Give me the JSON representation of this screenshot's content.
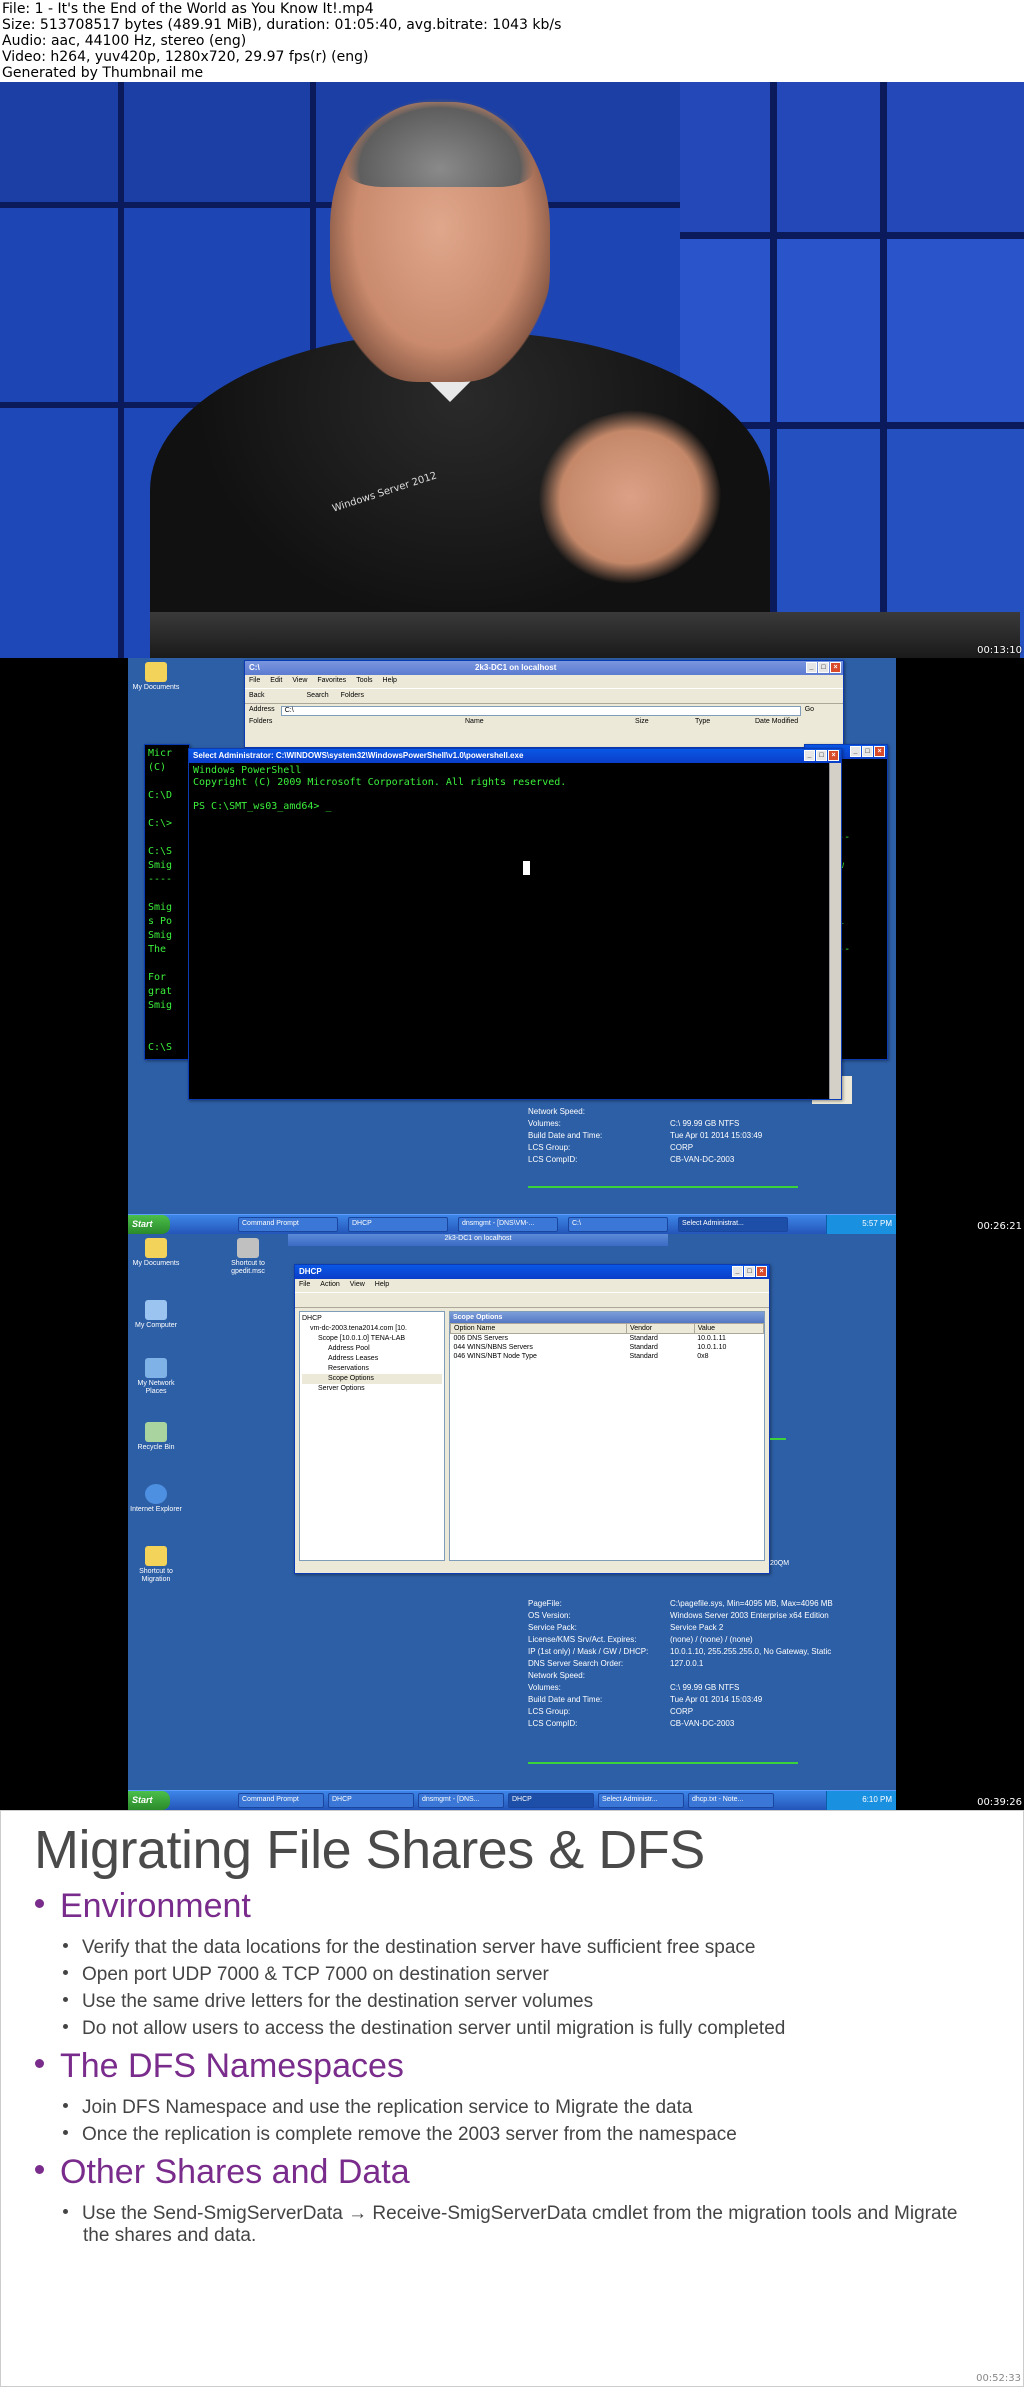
{
  "info": {
    "line1": "File: 1 - It's the End of the World as You Know It!.mp4",
    "line2": "Size: 513708517 bytes (489.91 MiB), duration: 01:05:40, avg.bitrate: 1043 kb/s",
    "line3": "Audio: aac, 44100 Hz, stereo (eng)",
    "line4": "Video: h264, yuv420p, 1280x720, 29.97 fps(r) (eng)",
    "line5": "Generated by Thumbnail me"
  },
  "timestamps": [
    "00:13:10",
    "00:26:21",
    "00:39:26",
    "00:52:33"
  ],
  "frame1": {
    "shirt_logo": "Windows Server 2012"
  },
  "frame2": {
    "icons": [
      "My Documents"
    ],
    "explorer": {
      "title": "C:\\",
      "title_center": "2k3-DC1 on localhost",
      "menu": [
        "File",
        "Edit",
        "View",
        "Favorites",
        "Tools",
        "Help"
      ],
      "toolbar": [
        "Back",
        "Search",
        "Folders"
      ],
      "address_label": "Address",
      "address_value": "C:\\",
      "go": "Go",
      "cols": [
        "Folders",
        "Name",
        "Size",
        "Type",
        "Date Modified"
      ]
    },
    "cmd_left": [
      "Micr",
      "(C)",
      "",
      "C:\\D",
      "",
      "C:\\>",
      "",
      "C:\\S",
      "Smig",
      "----",
      "",
      "Smig",
      "s Po",
      "Smig",
      "The ",
      "",
      "For ",
      "grat",
      "Smig",
      "",
      "",
      "C:\\S"
    ],
    "cmd_right": [
      "",
      "",
      "",
      "",
      "",
      "-------",
      "",
      "Window",
      "",
      "",
      "",
      "the mi",
      "",
      "-------"
    ],
    "powershell": {
      "title": "Select Administrator: C:\\WINDOWS\\system32\\WindowsPowerShell\\v1.0\\powershell.exe",
      "lines": [
        "Windows PowerShell",
        "Copyright (C) 2009 Microsoft Corporation. All rights reserved.",
        "",
        "PS C:\\SMT_ws03_amd64> _"
      ]
    },
    "sysinfo": [
      [
        "Network Speed:",
        ""
      ],
      [
        "Volumes:",
        "C:\\ 99.99 GB NTFS"
      ],
      [
        "Build Date and Time:",
        "Tue Apr 01 2014 15:03:49"
      ],
      [
        "LCS Group:",
        "CORP"
      ],
      [
        "LCS CompID:",
        "CB-VAN-DC-2003"
      ]
    ],
    "static_label": "tatic",
    "taskbar": {
      "start": "Start",
      "buttons": [
        "Command Prompt",
        "DHCP",
        "dnsmgmt - [DNS\\VM-...",
        "C:\\",
        "Select Administrat..."
      ],
      "clock": "5:57 PM"
    }
  },
  "frame3": {
    "icons": [
      "My Documents",
      "My Computer",
      "My Network Places",
      "Recycle Bin",
      "Internet Explorer",
      "Shortcut to Migration",
      "Shortcut to gpedit.msc"
    ],
    "remote_title": "2k3-DC1 on localhost",
    "dhcp": {
      "title": "DHCP",
      "menu": [
        "File",
        "Action",
        "View",
        "Help"
      ],
      "tree": [
        "DHCP",
        "vm-dc-2003.tena2014.com [10.",
        "Scope [10.0.1.0] TENA-LAB",
        "Address Pool",
        "Address Leases",
        "Reservations",
        "Scope Options",
        "Server Options"
      ],
      "panel_title": "Scope Options",
      "columns": [
        "Option Name",
        "Vendor",
        "Value"
      ],
      "rows": [
        [
          "006 DNS Servers",
          "Standard",
          "10.0.1.11"
        ],
        [
          "044 WINS/NBNS Servers",
          "Standard",
          "10.0.1.10"
        ],
        [
          "046 WINS/NBT Node Type",
          "Standard",
          "0x8"
        ]
      ]
    },
    "side_label": "20QM",
    "sysinfo": [
      [
        "PageFile:",
        "C:\\pagefile.sys, Min=4095 MB, Max=4096 MB"
      ],
      [
        "OS Version:",
        "Windows Server 2003 Enterprise x64 Edition"
      ],
      [
        "Service Pack:",
        "Service Pack 2"
      ],
      [
        "License/KMS Srv/Act. Expires:",
        "(none) / (none) / (none)"
      ],
      [
        "IP (1st only) / Mask / GW / DHCP:",
        "10.0.1.10, 255.255.255.0, No Gateway, Static"
      ],
      [
        "DNS Server Search Order:",
        "127.0.0.1"
      ],
      [
        "Network Speed:",
        ""
      ],
      [
        "Volumes:",
        "C:\\ 99.99 GB NTFS"
      ],
      [
        "Build Date and Time:",
        "Tue Apr 01 2014 15:03:49"
      ],
      [
        "LCS Group:",
        "CORP"
      ],
      [
        "LCS CompID:",
        "CB-VAN-DC-2003"
      ]
    ],
    "taskbar": {
      "start": "Start",
      "buttons": [
        "Command Prompt",
        "DHCP",
        "dnsmgmt - [DNS...",
        "DHCP",
        "Select Administr...",
        "dhcp.txt - Note..."
      ],
      "clock": "6:10 PM"
    }
  },
  "slide": {
    "title": "Migrating File Shares & DFS",
    "sections": [
      {
        "heading": "Environment",
        "items": [
          "Verify that the data locations for the destination server have sufficient free space",
          "Open port UDP 7000 & TCP 7000 on destination server",
          "Use the same drive letters for the destination server volumes",
          "Do not allow users to access the destination server until migration is fully completed"
        ]
      },
      {
        "heading": "The DFS Namespaces",
        "items": [
          "Join DFS Namespace and use the replication service to Migrate the data",
          "Once the replication is complete remove the 2003 server from the namespace"
        ]
      },
      {
        "heading": "Other Shares and Data",
        "items": [
          "Use the Send-SmigServerData → Receive-SmigServerData cmdlet from the migration tools and Migrate the shares and data."
        ]
      }
    ]
  }
}
